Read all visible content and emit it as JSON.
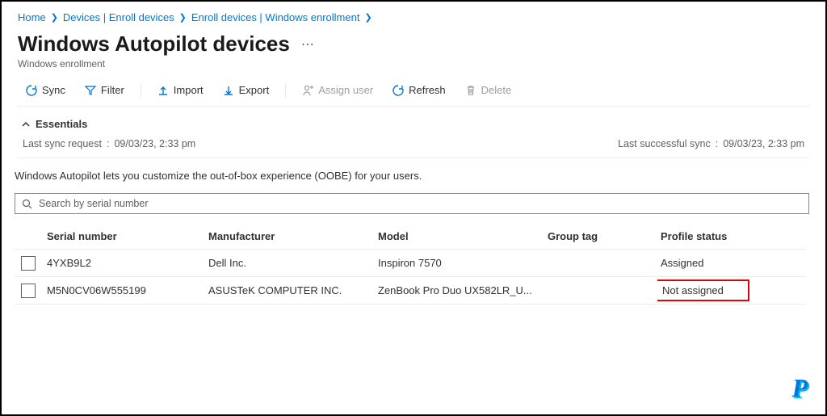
{
  "breadcrumb": [
    {
      "label": "Home"
    },
    {
      "label": "Devices | Enroll devices"
    },
    {
      "label": "Enroll devices | Windows enrollment"
    }
  ],
  "page": {
    "title": "Windows Autopilot devices",
    "subtitle": "Windows enrollment"
  },
  "toolbar": {
    "sync": "Sync",
    "filter": "Filter",
    "import": "Import",
    "export": "Export",
    "assign": "Assign user",
    "refresh": "Refresh",
    "delete": "Delete"
  },
  "essentials": {
    "heading": "Essentials",
    "last_sync_request_label": "Last sync request",
    "last_sync_request_value": "09/03/23, 2:33 pm",
    "last_success_label": "Last successful sync",
    "last_success_value": "09/03/23, 2:33 pm"
  },
  "description": "Windows Autopilot lets you customize the out-of-box experience (OOBE) for your users.",
  "search": {
    "placeholder": "Search by serial number"
  },
  "columns": {
    "serial": "Serial number",
    "manufacturer": "Manufacturer",
    "model": "Model",
    "group_tag": "Group tag",
    "profile_status": "Profile status"
  },
  "rows": [
    {
      "serial": "4YXB9L2",
      "manufacturer": "Dell Inc.",
      "model": "Inspiron 7570",
      "group_tag": "",
      "profile_status": "Assigned",
      "highlight": false
    },
    {
      "serial": "M5N0CV06W555199",
      "manufacturer": "ASUSTeK COMPUTER INC.",
      "model": "ZenBook Pro Duo UX582LR_U...",
      "group_tag": "",
      "profile_status": "Not assigned",
      "highlight": true
    }
  ],
  "logo": "P"
}
